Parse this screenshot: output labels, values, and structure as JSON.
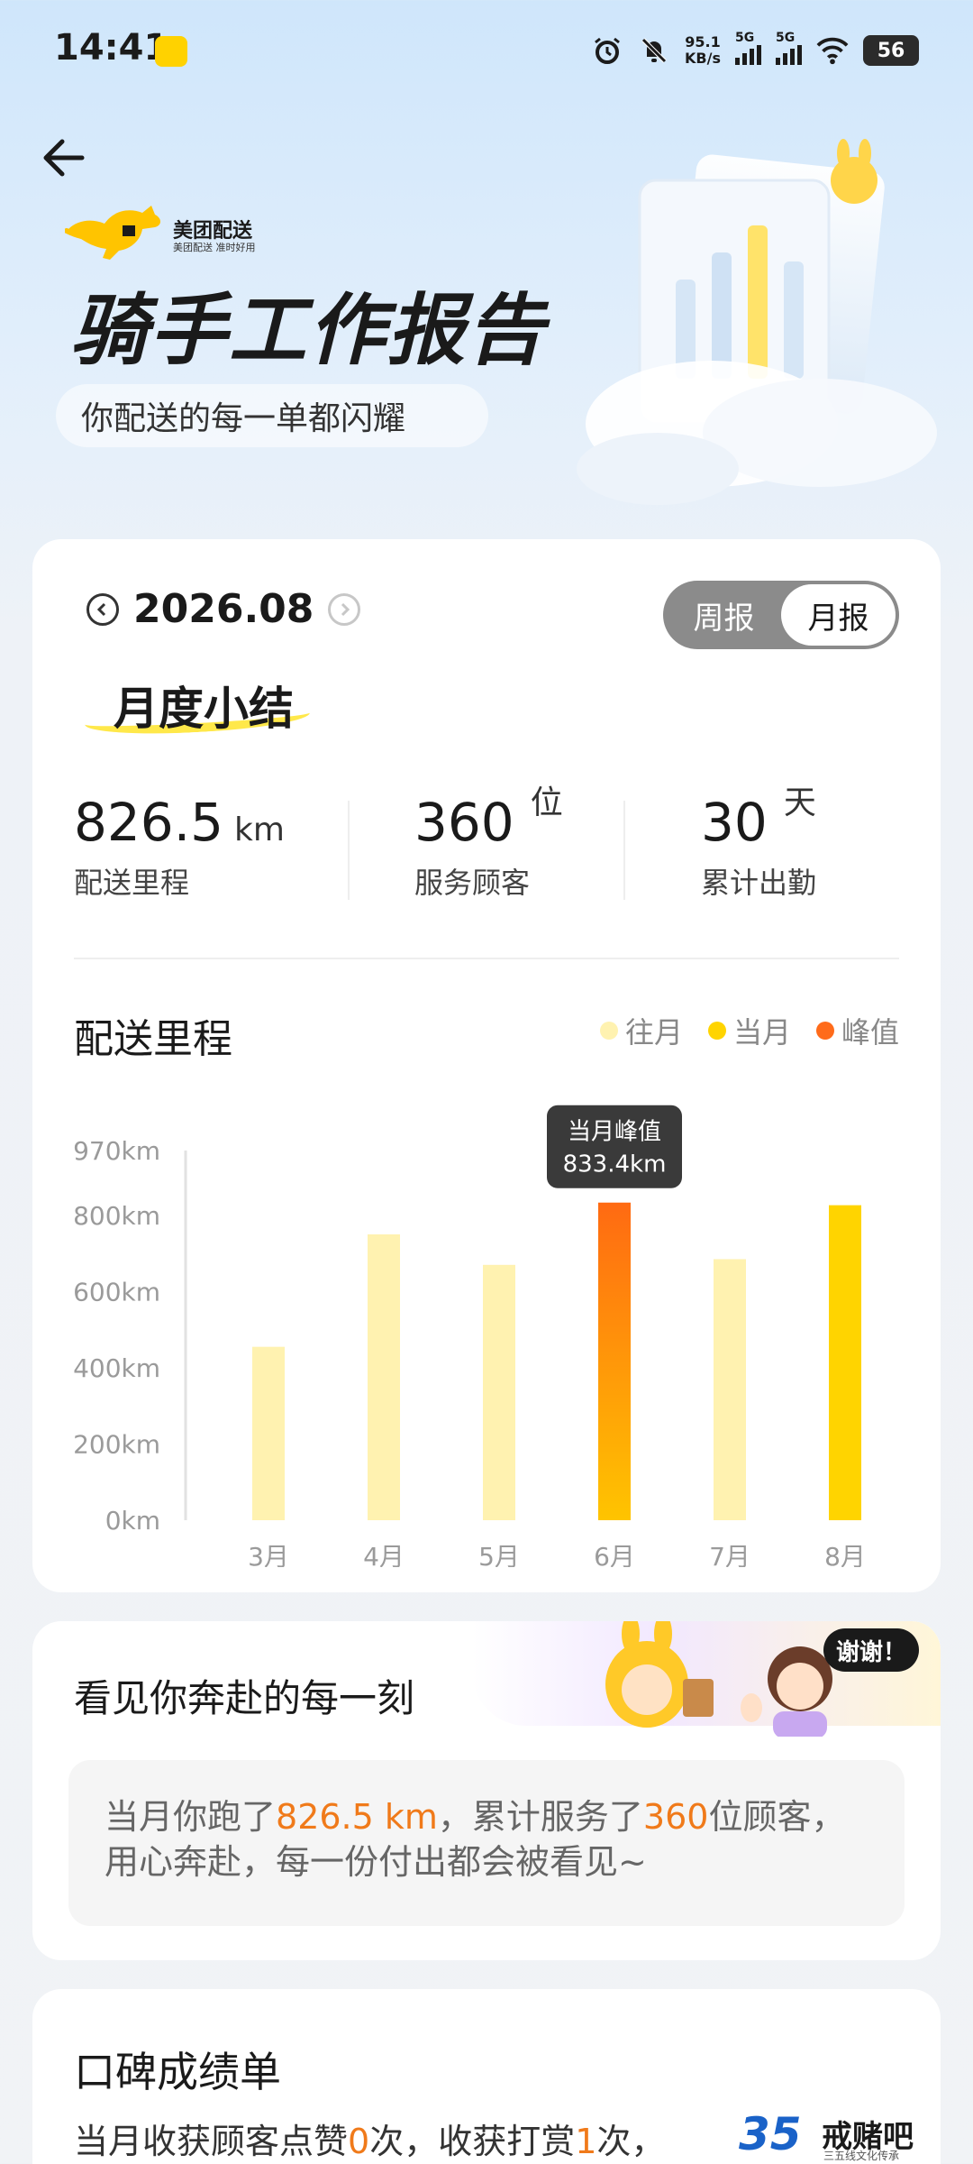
{
  "status_bar": {
    "time": "14:41",
    "net_speed_value": "95.1",
    "net_speed_unit": "KB/s",
    "sim1": "5G",
    "sim2": "5G",
    "battery": "56"
  },
  "header": {
    "brand_name": "美团配送",
    "brand_slogan": "美团配送 准时好用",
    "title": "骑手工作报告",
    "subtitle": "你配送的每一单都闪耀"
  },
  "summary": {
    "month": "2026.08",
    "toggle_options": [
      "周报",
      "月报"
    ],
    "active_toggle": "月报",
    "section_title": "月度小结",
    "stats": [
      {
        "value": "826.5",
        "unit": "km",
        "label": "配送里程"
      },
      {
        "value": "360",
        "unit": "位",
        "label": "服务顾客"
      },
      {
        "value": "30",
        "unit": "天",
        "label": "累计出勤"
      }
    ]
  },
  "chart_data": {
    "type": "bar",
    "title": "配送里程",
    "categories": [
      "3月",
      "4月",
      "5月",
      "6月",
      "7月",
      "8月"
    ],
    "values": [
      455,
      750,
      670,
      833.4,
      685,
      826.5
    ],
    "bar_kind": [
      "past",
      "past",
      "past",
      "peak",
      "past",
      "current"
    ],
    "y_ticks": [
      "0km",
      "200km",
      "400km",
      "600km",
      "800km",
      "970km"
    ],
    "y_tick_values": [
      0,
      200,
      400,
      600,
      800,
      970
    ],
    "ylim": [
      0,
      970
    ],
    "legend": [
      {
        "label": "往月",
        "color": "#fff2b0"
      },
      {
        "label": "当月",
        "color": "#ffd400"
      },
      {
        "label": "峰值",
        "color": "#ff6b1a"
      }
    ],
    "tooltip": {
      "title": "当月峰值",
      "value": "833.4km",
      "category_index": 3
    }
  },
  "moment": {
    "title": "看见你奔赴的每一刻",
    "thanks": "谢谢！",
    "text_part1": "当月你跑了",
    "text_km": "826.5 km",
    "text_part2": "，累计服务了",
    "text_count": "360",
    "text_part3": "位顾客，用心奔赴，每一份付出都会被看见~"
  },
  "reputation": {
    "title": "口碑成绩单",
    "line_part1": "当月收获顾客点赞",
    "likes": "0",
    "line_part2": "次，收获打赏",
    "tips": "1",
    "line_part3": "次，"
  },
  "watermark": {
    "number": "35",
    "name": "戒赌吧",
    "sub": "三五线文化传承"
  },
  "colors": {
    "accent_orange": "#f07a1a",
    "brand_yellow": "#ffd400",
    "past_bar": "#fff2b0",
    "peak_bar": "#ff6b1a"
  }
}
